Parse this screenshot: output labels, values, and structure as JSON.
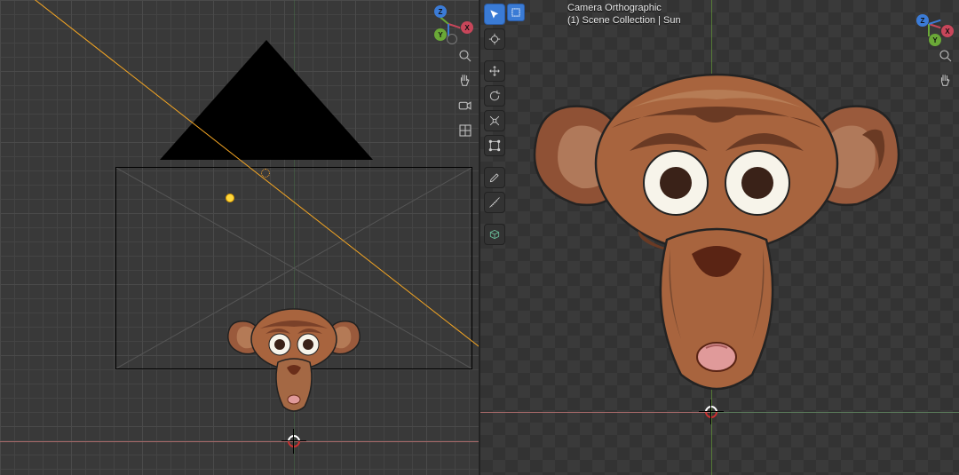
{
  "right_header": {
    "line1": "Camera Orthographic",
    "line2": "(1) Scene Collection | Sun"
  },
  "gizmo": {
    "axes": [
      "X",
      "Y",
      "Z"
    ]
  },
  "left_toolbar": {
    "zoom": "zoom-icon",
    "pan": "pan-icon",
    "camera_view": "camera-icon",
    "grid_toggle": "grid-icon"
  },
  "right_toolbar_overlay": {
    "select_box": "select-box-icon",
    "cursor": "cursor-icon",
    "move": "move-icon",
    "rotate": "rotate-icon",
    "scale": "scale-icon",
    "transform": "transform-icon",
    "annotate": "annotate-icon",
    "measure": "measure-icon",
    "add_cube": "add-cube-icon"
  },
  "right_side_icons": {
    "zoom": "zoom-icon",
    "pan": "pan-icon"
  },
  "colors": {
    "axis_x": "#c8465a",
    "axis_y": "#6aa837",
    "axis_z": "#3b7bd6",
    "sun": "#f5a623",
    "floor_pink_left": "#a86a6a",
    "floor_green_right": "#5a7a5a"
  },
  "scene_objects": {
    "camera": "Camera",
    "light": "Sun",
    "mesh": "Suzanne",
    "triangle": "Triangle"
  }
}
